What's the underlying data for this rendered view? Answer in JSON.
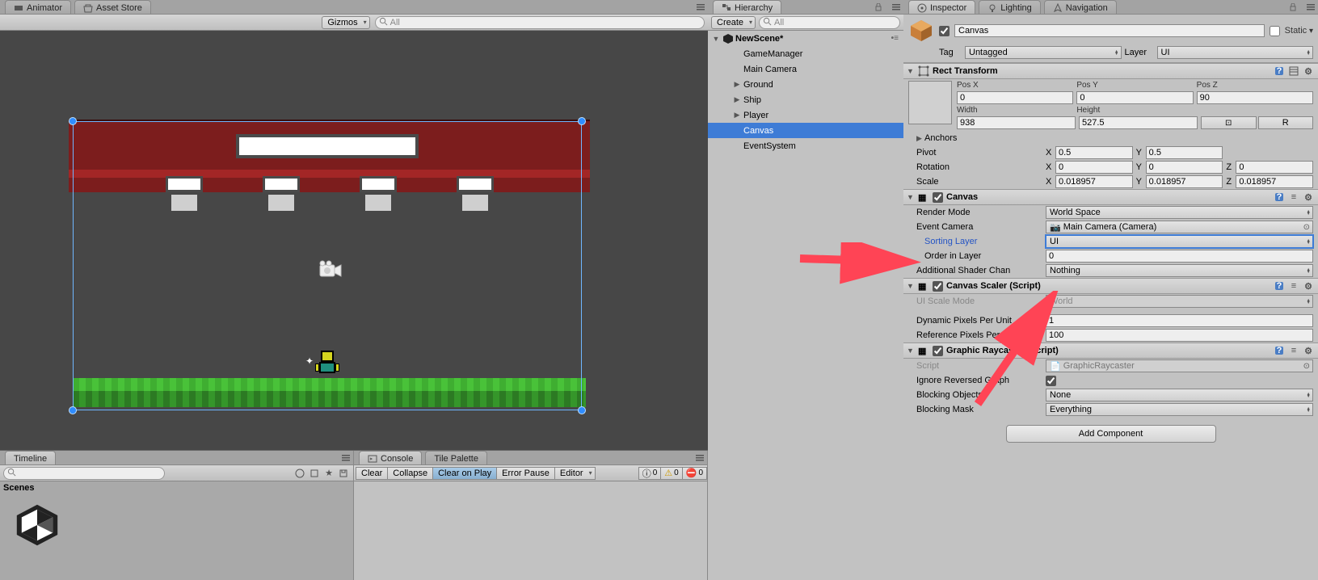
{
  "tabs_top_left": {
    "animator": "Animator",
    "asset_store": "Asset Store"
  },
  "scene_toolbar": {
    "gizmos": "Gizmos",
    "search_placeholder": "All"
  },
  "timeline": {
    "title": "Timeline",
    "scenes": "Scenes"
  },
  "console": {
    "tab_console": "Console",
    "tab_tile": "Tile Palette",
    "btn_clear": "Clear",
    "btn_collapse": "Collapse",
    "btn_clearplay": "Clear on Play",
    "btn_errpause": "Error Pause",
    "btn_editor": "Editor",
    "count_info": "0",
    "count_warn": "0",
    "count_err": "0"
  },
  "hierarchy": {
    "title": "Hierarchy",
    "create": "Create",
    "search_placeholder": "All",
    "scene": "NewScene*",
    "items": [
      "GameManager",
      "Main Camera",
      "Ground",
      "Ship",
      "Player",
      "Canvas",
      "EventSystem"
    ],
    "expandable": [
      false,
      false,
      true,
      true,
      true,
      false,
      false
    ],
    "selected_index": 5
  },
  "inspector_tabs": {
    "inspector": "Inspector",
    "lighting": "Lighting",
    "navigation": "Navigation"
  },
  "go": {
    "name": "Canvas",
    "active": true,
    "static_label": "Static",
    "tag_label": "Tag",
    "tag": "Untagged",
    "layer_label": "Layer",
    "layer": "UI"
  },
  "rect": {
    "title": "Rect Transform",
    "posx_l": "Pos X",
    "posy_l": "Pos Y",
    "posz_l": "Pos Z",
    "posx": "0",
    "posy": "0",
    "posz": "90",
    "width_l": "Width",
    "height_l": "Height",
    "width": "938",
    "height": "527.5",
    "r_btn": "R",
    "anchors": "Anchors",
    "pivot_l": "Pivot",
    "pivot_x": "0.5",
    "pivot_y": "0.5",
    "rot_l": "Rotation",
    "rot_x": "0",
    "rot_y": "0",
    "rot_z": "0",
    "scale_l": "Scale",
    "scale_x": "0.018957",
    "scale_y": "0.018957",
    "scale_z": "0.018957"
  },
  "canvas_comp": {
    "title": "Canvas",
    "render_mode_l": "Render Mode",
    "render_mode": "World Space",
    "event_cam_l": "Event Camera",
    "event_cam": "Main Camera (Camera)",
    "sorting_l": "Sorting Layer",
    "sorting": "UI",
    "order_l": "Order in Layer",
    "order": "0",
    "shader_l": "Additional Shader Chan",
    "shader": "Nothing"
  },
  "scaler": {
    "title": "Canvas Scaler (Script)",
    "mode_l": "UI Scale Mode",
    "mode": "World",
    "dpu_l": "Dynamic Pixels Per Unit",
    "dpu": "1",
    "rpu_l": "Reference Pixels Per Un",
    "rpu": "100"
  },
  "raycast": {
    "title": "Graphic Raycaster (Script)",
    "script_l": "Script",
    "script": "GraphicRaycaster",
    "ignore_l": "Ignore Reversed Graph",
    "block_l": "Blocking Objects",
    "block": "None",
    "mask_l": "Blocking Mask",
    "mask": "Everything"
  },
  "add_component": "Add Component"
}
